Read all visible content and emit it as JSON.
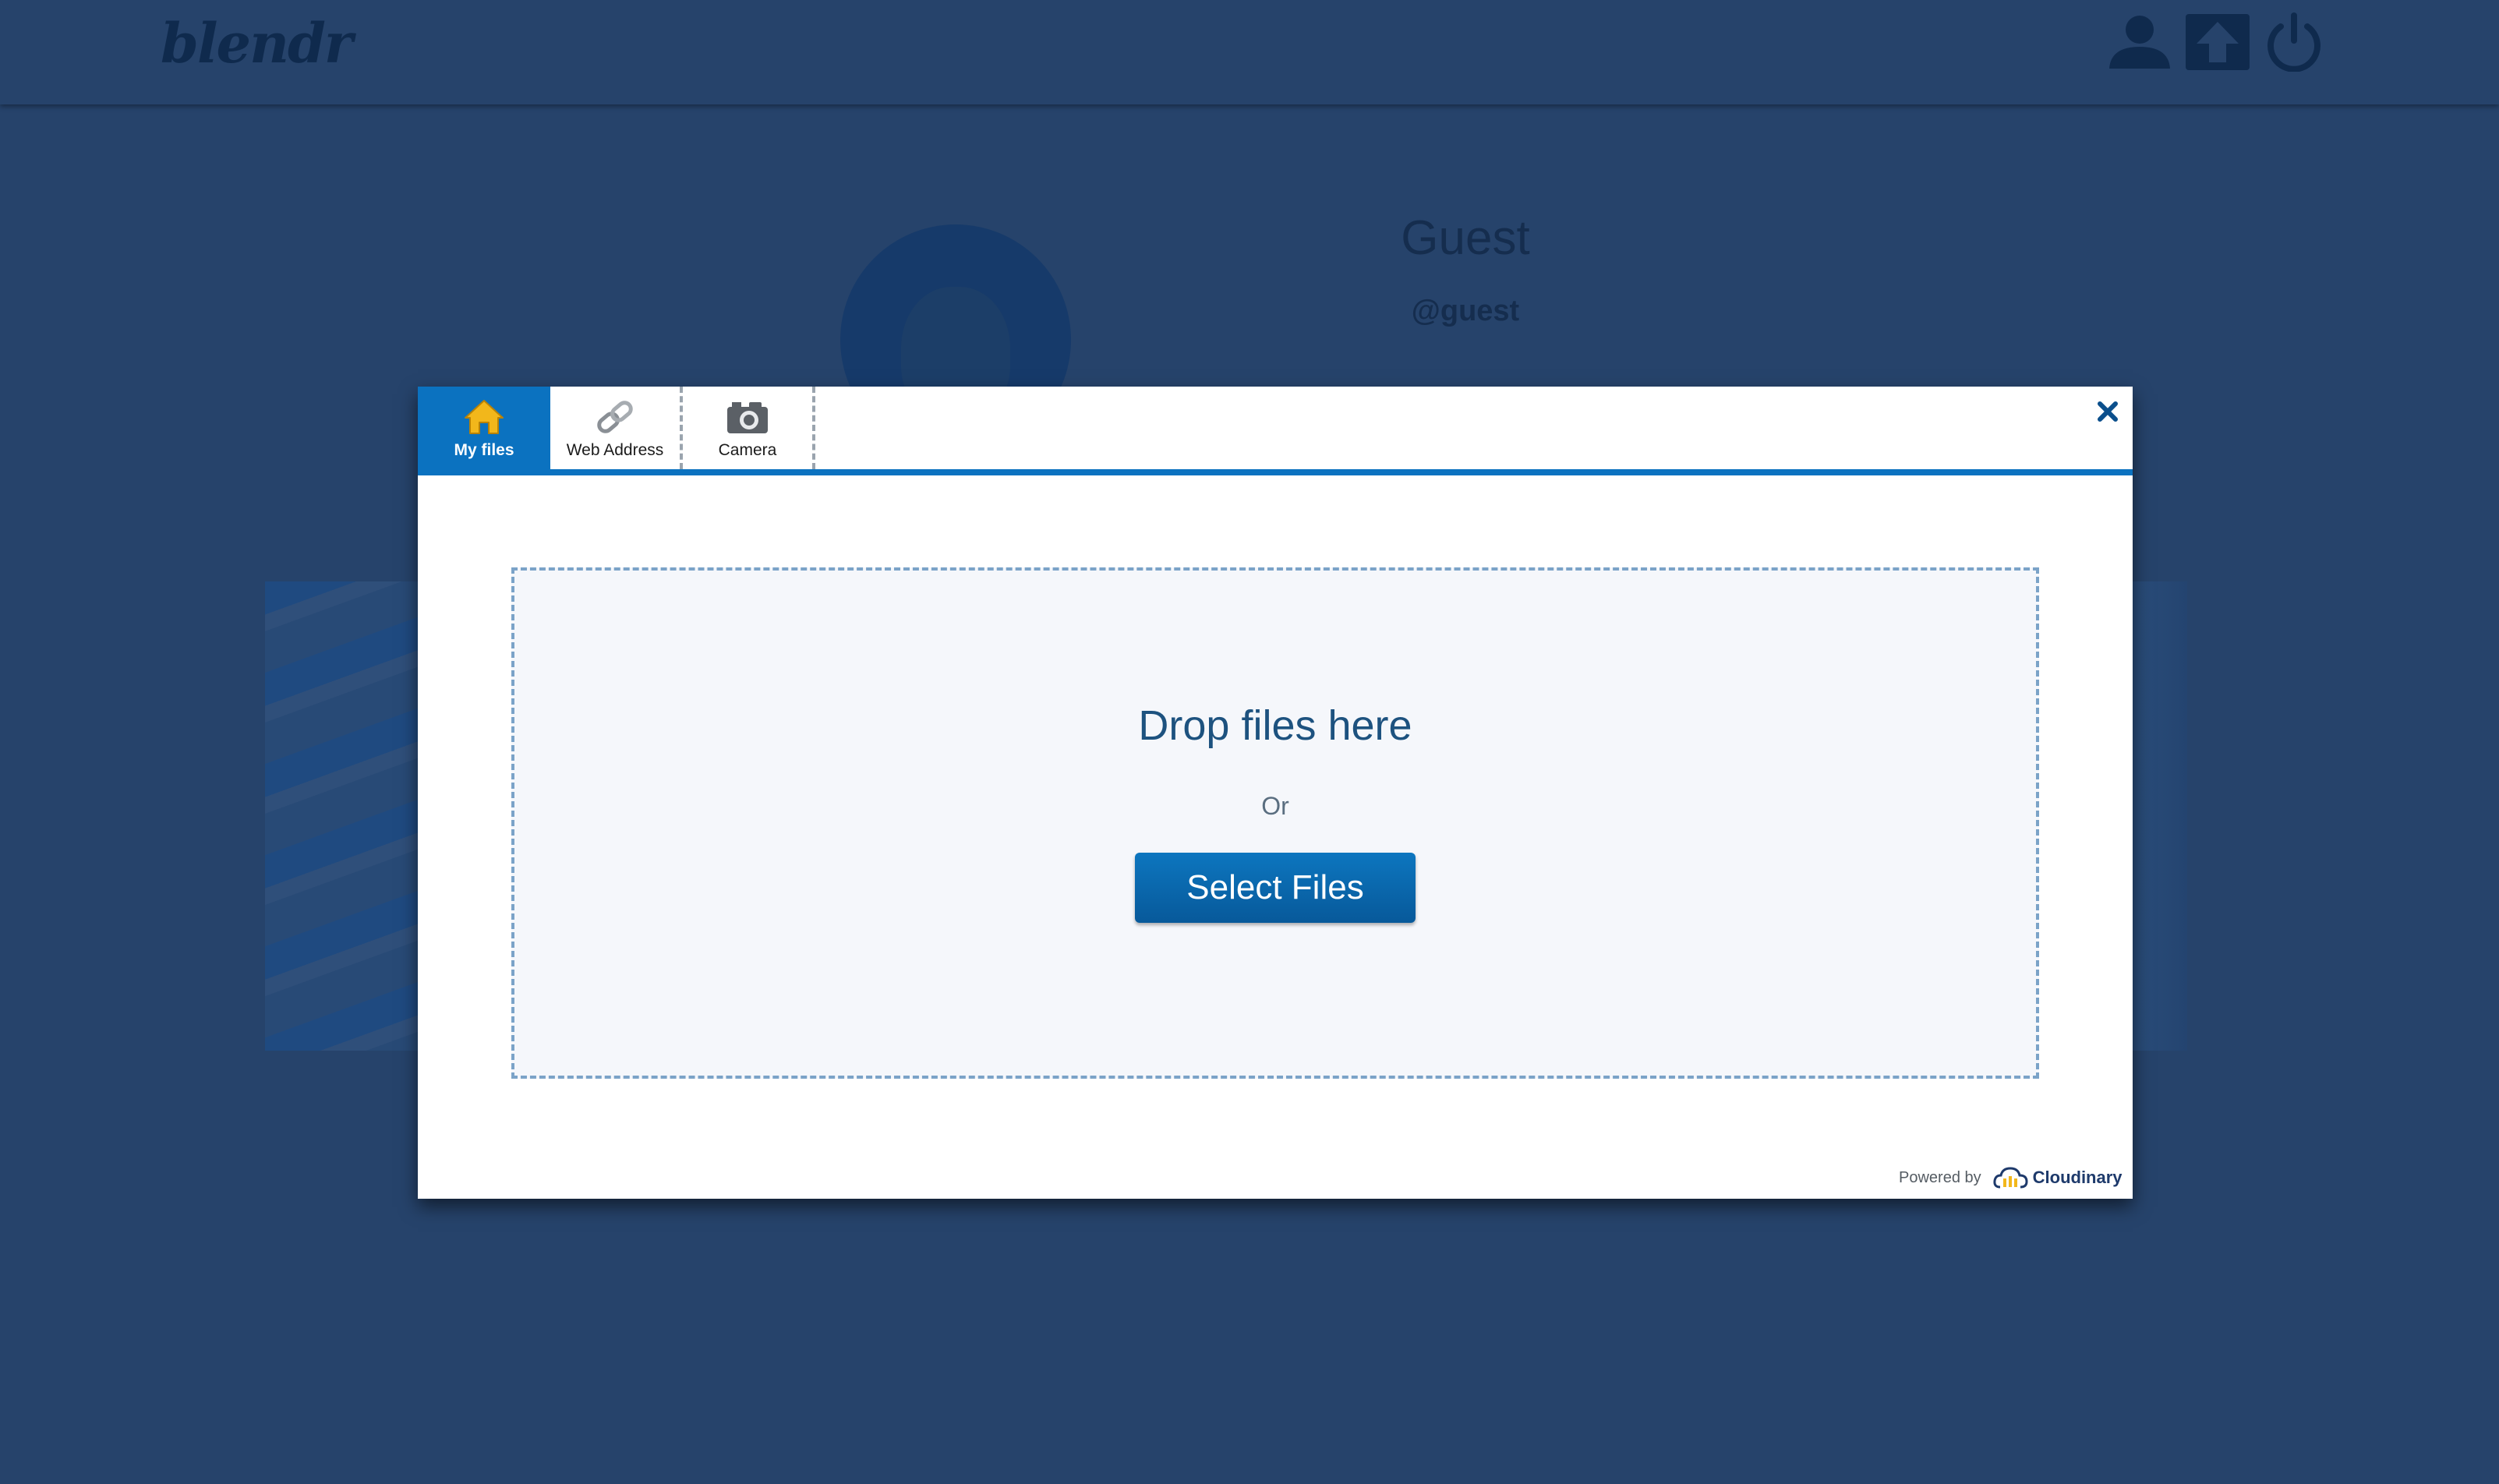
{
  "app": {
    "logo_text": "blendr"
  },
  "header_icons": [
    {
      "name": "user-icon"
    },
    {
      "name": "upload-icon"
    },
    {
      "name": "power-icon"
    }
  ],
  "profile": {
    "name": "Guest",
    "handle": "@guest"
  },
  "widget": {
    "tabs": [
      {
        "label": "My files",
        "icon": "home-icon",
        "active": true
      },
      {
        "label": "Web Address",
        "icon": "link-icon",
        "active": false
      },
      {
        "label": "Camera",
        "icon": "camera-icon",
        "active": false
      }
    ],
    "close_icon": "close-icon",
    "drop_title": "Drop files here",
    "or_text": "Or",
    "select_button": "Select Files",
    "powered_by": "Powered by",
    "brand": "Cloudinary"
  },
  "colors": {
    "page_bg": "#26436b",
    "accent": "#0b72c0",
    "home_icon": "#f2b71b"
  }
}
